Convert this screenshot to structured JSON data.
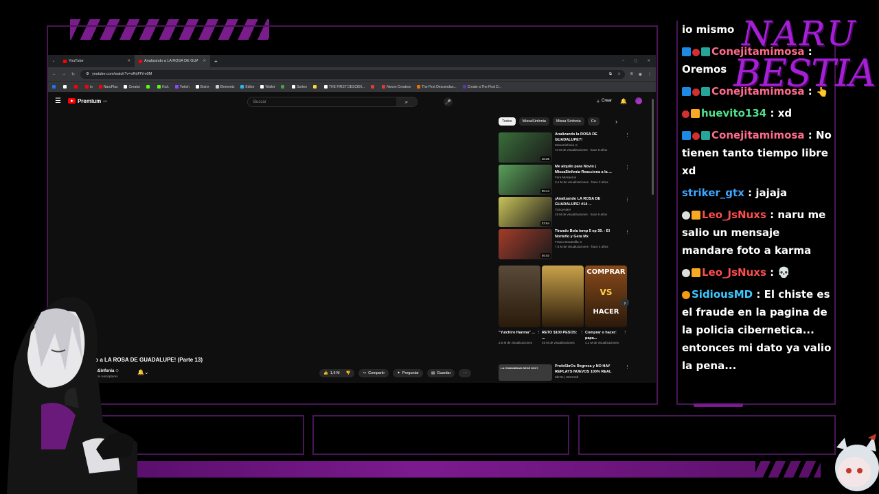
{
  "browser": {
    "tabs": [
      {
        "label": "YouTube",
        "active": false
      },
      {
        "label": "Analizando a LA ROSA DE GUADAL",
        "active": true
      }
    ],
    "new_tab": "+",
    "url": "youtube.com/watch?v=oRdFfYm0M",
    "bookmarks": [
      {
        "label": "",
        "color": "#1877f2"
      },
      {
        "label": "",
        "color": "#ffffff"
      },
      {
        "label": "",
        "color": "#ff0000"
      },
      {
        "label": "io",
        "color": "#ff0000"
      },
      {
        "label": "NaruPlus",
        "color": "#ff0000"
      },
      {
        "label": "Creator",
        "color": "#ffffff"
      },
      {
        "label": "",
        "color": "#53fc18"
      },
      {
        "label": "Kick",
        "color": "#53fc18"
      },
      {
        "label": "Twitch",
        "color": "#9146ff"
      },
      {
        "label": "Botrix",
        "color": "#ffffff"
      },
      {
        "label": "Elements",
        "color": "#cccccc"
      },
      {
        "label": "Editor",
        "color": "#29b6f6"
      },
      {
        "label": "Wallet",
        "color": "#ffffff"
      },
      {
        "label": "",
        "color": "#43a047"
      },
      {
        "label": "Sorteo",
        "color": "#ffffff"
      },
      {
        "label": "",
        "color": "#fdd835"
      },
      {
        "label": "THE FIRST DESCEN...",
        "color": "#ffffff"
      },
      {
        "label": "",
        "color": "#e53935"
      },
      {
        "label": "Nexon Creators",
        "color": "#e53935"
      },
      {
        "label": "The First Descendan...",
        "color": "#ef6c00"
      },
      {
        "label": "Create a The First D...",
        "color": "#5e35b1"
      }
    ]
  },
  "youtube": {
    "logo_text": "Premium",
    "logo_sup": "MX",
    "search_placeholder": "Buscar",
    "create_label": "Crear",
    "video_title": "zando a LA ROSA DE GUADALUPE! (Parte 13)",
    "channel_name": "MissaSinfonia",
    "channel_verified": "⊙",
    "subscribers": "20,8 M de suscriptores",
    "actions": {
      "likes": "1,6 M",
      "share": "Compartir",
      "ask": "Preguntar",
      "save": "Guardar",
      "more": "···"
    },
    "chips": [
      {
        "label": "Todos",
        "active": true
      },
      {
        "label": "MissaSinfonia",
        "active": false
      },
      {
        "label": "Missa Sinfonia",
        "active": false
      },
      {
        "label": "Co",
        "active": false
      }
    ],
    "recommendations": [
      {
        "title": "Analizando la ROSA DE GUADALUPE?!",
        "channel": "MissaSinfonia ⊙",
        "meta": "72 M de visualizaciones · hace 8 años",
        "duration": "18:35",
        "thumb": "#3a6e3a"
      },
      {
        "title": "Me alquilo para Novio | MissaSinfonia Reacciona a la ...",
        "channel": "Fara Missauros",
        "meta": "3,1 M de visualizaciones · hace 2 años",
        "duration": "25:44",
        "thumb": "#5aa05a"
      },
      {
        "title": "¡Analizando LA ROSA DE GUADALUPE! #14 ...",
        "channel": "YoSoyAlan!",
        "meta": "19 M de visualizaciones · hace 5 años",
        "duration": "23:54",
        "thumb": "#c9c35a"
      },
      {
        "title": "Tirando Bola temp 5 ep 39. - El Norteño y Gera Mx",
        "channel": "Franco Escamilla ⊙",
        "meta": "7,3 M de visualizaciones · hace 4 años",
        "duration": "55:03",
        "thumb": "#a33c2a"
      }
    ],
    "shorts": [
      {
        "title": "\"Yulchiro Hanma\" ...",
        "views": "2,5 M de visualizaciones",
        "thumb": "#5a4a3a"
      },
      {
        "title": "RETO $100 PESOS: ...",
        "views": "45 M de visualizaciones",
        "thumb": "#c9a24a"
      },
      {
        "title": "Comprar o hacer: papa...",
        "views": "4,1 M de visualizaciones",
        "thumb": "#8a4a1a",
        "overlay_top": "COMPRAR",
        "overlay_mid": "VS",
        "overlay_bottom": "HACER"
      }
    ],
    "last_rec": {
      "title": "ProfeSkrOs Regresa y NO HAY REPLAYS NUEVOS 100% REAL",
      "channel": "SkrOs | StarCraft",
      "thumb_text": "LA COMUNIDAD DEJÓ SC2?"
    }
  },
  "chat": {
    "messages": [
      {
        "user": "",
        "user_color": "#ffffff",
        "text": "io mismo",
        "badges": []
      },
      {
        "user": "Conejitamimosa",
        "user_color": "#ff6b8a",
        "text": "Oremos",
        "badges": [
          "prime",
          "dot",
          "sub"
        ]
      },
      {
        "user": "Conejitamimosa",
        "user_color": "#ff6b8a",
        "text": "👆",
        "badges": [
          "prime",
          "dot",
          "sub"
        ]
      },
      {
        "user": "huevito134",
        "user_color": "#4ee08a",
        "text": "xd",
        "badges": [
          "dot",
          "crown"
        ]
      },
      {
        "user": "Conejitamimosa",
        "user_color": "#ff6b8a",
        "text": "No tienen tanto tiempo libre xd",
        "badges": [
          "prime",
          "dot",
          "sub"
        ]
      },
      {
        "user": "striker_gtx",
        "user_color": "#3ea6ff",
        "text": "jajaja",
        "badges": []
      },
      {
        "user": "Leo_JsNuxs",
        "user_color": "#ff4d4d",
        "text": "naru me salio un mensaje mandare foto a karma",
        "badges": [
          "white",
          "crown"
        ]
      },
      {
        "user": "Leo_JsNuxs",
        "user_color": "#ff4d4d",
        "text": "💀",
        "badges": [
          "white",
          "crown"
        ]
      },
      {
        "user": "SidiousMD",
        "user_color": "#3ec8ff",
        "text": "El chiste es el fraude en la pagina de la policia cibernetica... entonces mi dato ya valio la pena...",
        "badges": [
          "orange"
        ]
      }
    ]
  },
  "logo": {
    "line1": "NARU",
    "line2": "BESTIA"
  },
  "colors": {
    "accent": "#7b1a8f",
    "frame": "#4a1559",
    "youtube_red": "#ff0000"
  }
}
